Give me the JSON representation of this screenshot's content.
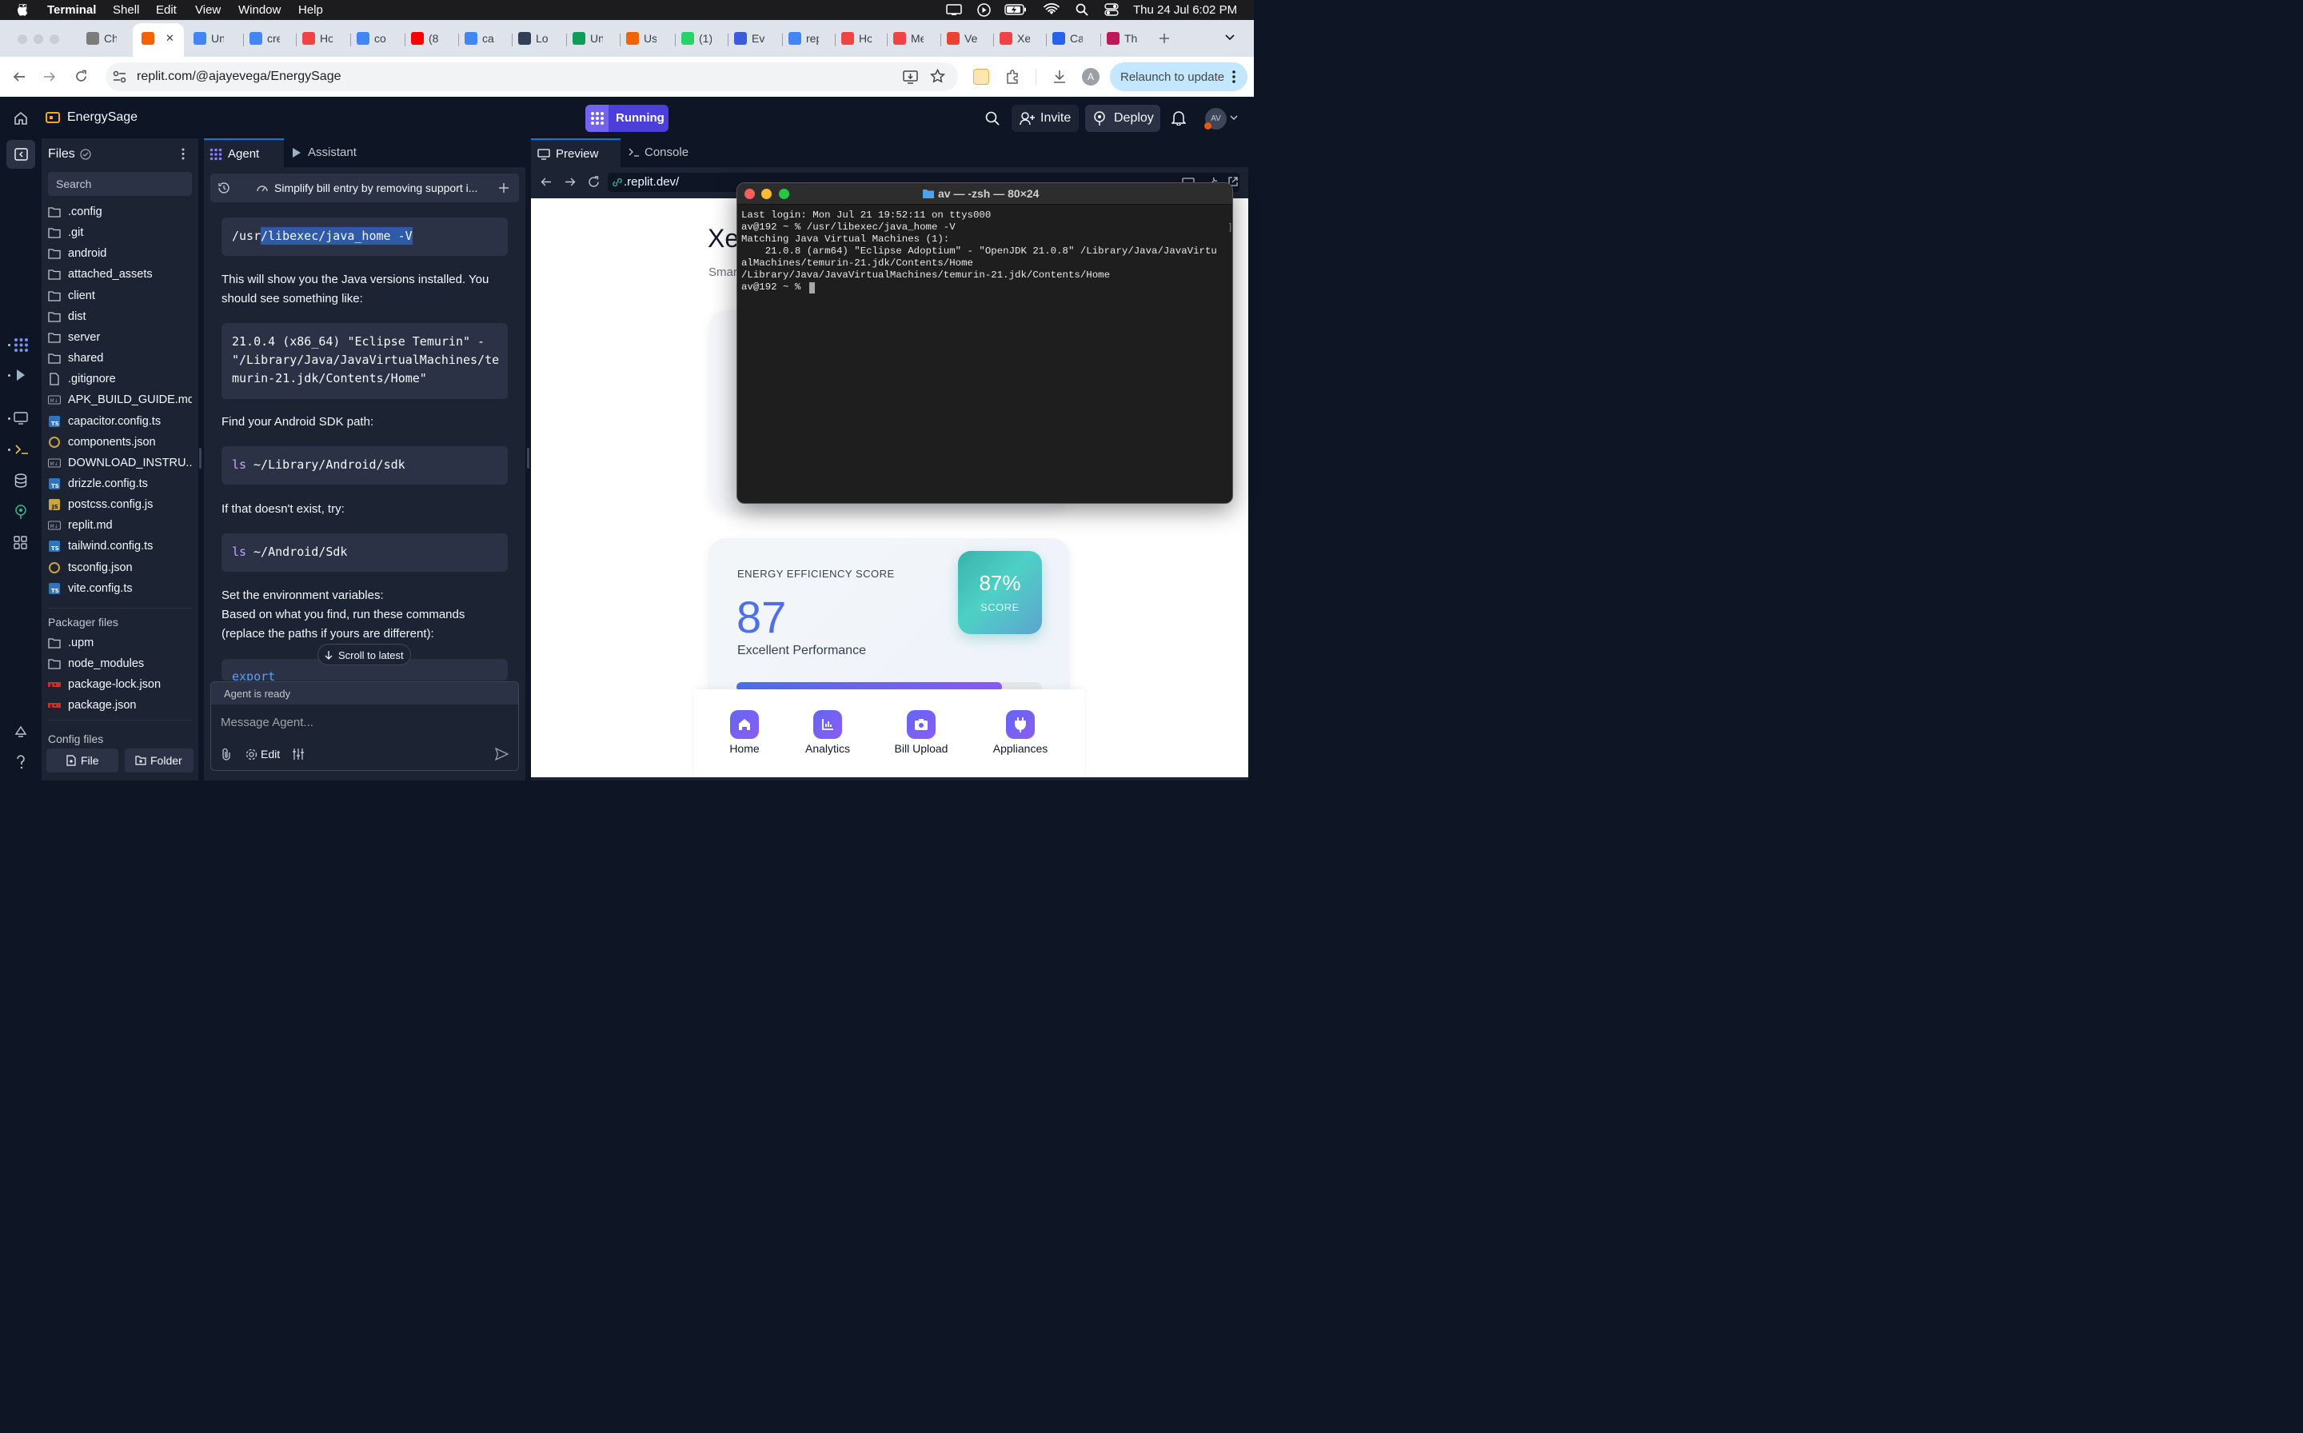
{
  "menubar": {
    "app": "Terminal",
    "items": [
      "Shell",
      "Edit",
      "View",
      "Window",
      "Help"
    ],
    "datetime": "Thu 24 Jul  6:02 PM"
  },
  "browser": {
    "tabs": [
      {
        "title": "Ch",
        "color": "#7c7c7c"
      },
      {
        "title": "",
        "color": "#f26207",
        "active": true
      },
      {
        "title": "Un",
        "color": "#4285f4"
      },
      {
        "title": "cre",
        "color": "#4285f4"
      },
      {
        "title": "Ho",
        "color": "#ef4444"
      },
      {
        "title": "co",
        "color": "#4285f4"
      },
      {
        "title": "(8",
        "color": "#ff0000"
      },
      {
        "title": "ca",
        "color": "#4285f4"
      },
      {
        "title": "Lo",
        "color": "#334155"
      },
      {
        "title": "Un",
        "color": "#0f9d58"
      },
      {
        "title": "Us",
        "color": "#f26207"
      },
      {
        "title": "(1)",
        "color": "#25d366"
      },
      {
        "title": "Ev",
        "color": "#3b5bdb"
      },
      {
        "title": "rep",
        "color": "#4285f4"
      },
      {
        "title": "Ho",
        "color": "#ef4444"
      },
      {
        "title": "Me",
        "color": "#ef4444"
      },
      {
        "title": "Ve",
        "color": "#ea4335"
      },
      {
        "title": "Xe",
        "color": "#ef4444"
      },
      {
        "title": "Ca",
        "color": "#2563eb"
      },
      {
        "title": "Th",
        "color": "#be185d"
      }
    ],
    "url": "replit.com/@ajayevega/EnergySage",
    "relaunch": "Relaunch to update",
    "profile_initial": "A"
  },
  "replit": {
    "project": "EnergySage",
    "run_status": "Running",
    "invite": "Invite",
    "deploy": "Deploy",
    "avatar": "AV"
  },
  "files": {
    "title": "Files",
    "search_placeholder": "Search",
    "items": [
      {
        "name": ".config",
        "type": "folder"
      },
      {
        "name": ".git",
        "type": "folder"
      },
      {
        "name": "android",
        "type": "folder"
      },
      {
        "name": "attached_assets",
        "type": "folder"
      },
      {
        "name": "client",
        "type": "folder"
      },
      {
        "name": "dist",
        "type": "folder"
      },
      {
        "name": "server",
        "type": "folder"
      },
      {
        "name": "shared",
        "type": "folder"
      },
      {
        "name": ".gitignore",
        "type": "file"
      },
      {
        "name": "APK_BUILD_GUIDE.md",
        "type": "md"
      },
      {
        "name": "capacitor.config.ts",
        "type": "ts"
      },
      {
        "name": "components.json",
        "type": "json"
      },
      {
        "name": "DOWNLOAD_INSTRU...",
        "type": "md"
      },
      {
        "name": "drizzle.config.ts",
        "type": "ts"
      },
      {
        "name": "postcss.config.js",
        "type": "js"
      },
      {
        "name": "replit.md",
        "type": "md"
      },
      {
        "name": "tailwind.config.ts",
        "type": "ts"
      },
      {
        "name": "tsconfig.json",
        "type": "json"
      },
      {
        "name": "vite.config.ts",
        "type": "ts"
      }
    ],
    "packager_title": "Packager files",
    "packager_items": [
      {
        "name": ".upm",
        "type": "folder"
      },
      {
        "name": "node_modules",
        "type": "folder"
      },
      {
        "name": "package-lock.json",
        "type": "npm"
      },
      {
        "name": "package.json",
        "type": "npm"
      }
    ],
    "config_title": "Config files",
    "new_file": "File",
    "new_folder": "Folder"
  },
  "agent": {
    "tabs": [
      "Agent",
      "Assistant"
    ],
    "thread_title": "Simplify bill entry by removing support i...",
    "code1_pre": "/usr",
    "code1_sel": "/libexec/java_home -V",
    "p1": "This will show you the Java versions installed. You should see something like:",
    "code2": "21.0.4 (x86_64) \"Eclipse Temurin\" - \"/Library/Java/JavaVirtualMachines/temurin-21.jdk/Contents/Home\"",
    "p2": "Find your Android SDK path:",
    "code3_cmd": "ls",
    "code3_arg": " ~/Library/Android/sdk",
    "p3": "If that doesn't exist, try:",
    "code4_cmd": "ls",
    "code4_arg": " ~/Android/Sdk",
    "p4a": "Set the environment variables:",
    "p4b": "Based on what you find, run these commands (replace the paths if yours are different):",
    "code5": "export",
    "scroll_latest": "Scroll to latest",
    "status": "Agent is ready",
    "input_placeholder": "Message Agent...",
    "edit": "Edit"
  },
  "preview": {
    "tabs": [
      "Preview",
      "Console"
    ],
    "url": ".replit.dev/",
    "app_title_fragment": "Xe",
    "app_sub_fragment": "Smar",
    "score_heading": "ENERGY EFFICIENCY SCORE",
    "score_value": "87",
    "score_label": "Excellent Performance",
    "score_badge": "87%",
    "score_badge_sub": "SCORE",
    "score_progress": 0.87,
    "nav": [
      "Home",
      "Analytics",
      "Bill Upload",
      "Appliances"
    ]
  },
  "terminal": {
    "title": "av — -zsh — 80×24",
    "lines": [
      "Last login: Mon Jul 21 19:52:11 on ttys000",
      "av@192 ~ % /usr/libexec/java_home -V",
      "Matching Java Virtual Machines (1):",
      "    21.0.8 (arm64) \"Eclipse Adoptium\" - \"OpenJDK 21.0.8\" /Library/Java/JavaVirtu",
      "alMachines/temurin-21.jdk/Contents/Home",
      "/Library/Java/JavaVirtualMachines/temurin-21.jdk/Contents/Home",
      "av@192 ~ % "
    ]
  }
}
